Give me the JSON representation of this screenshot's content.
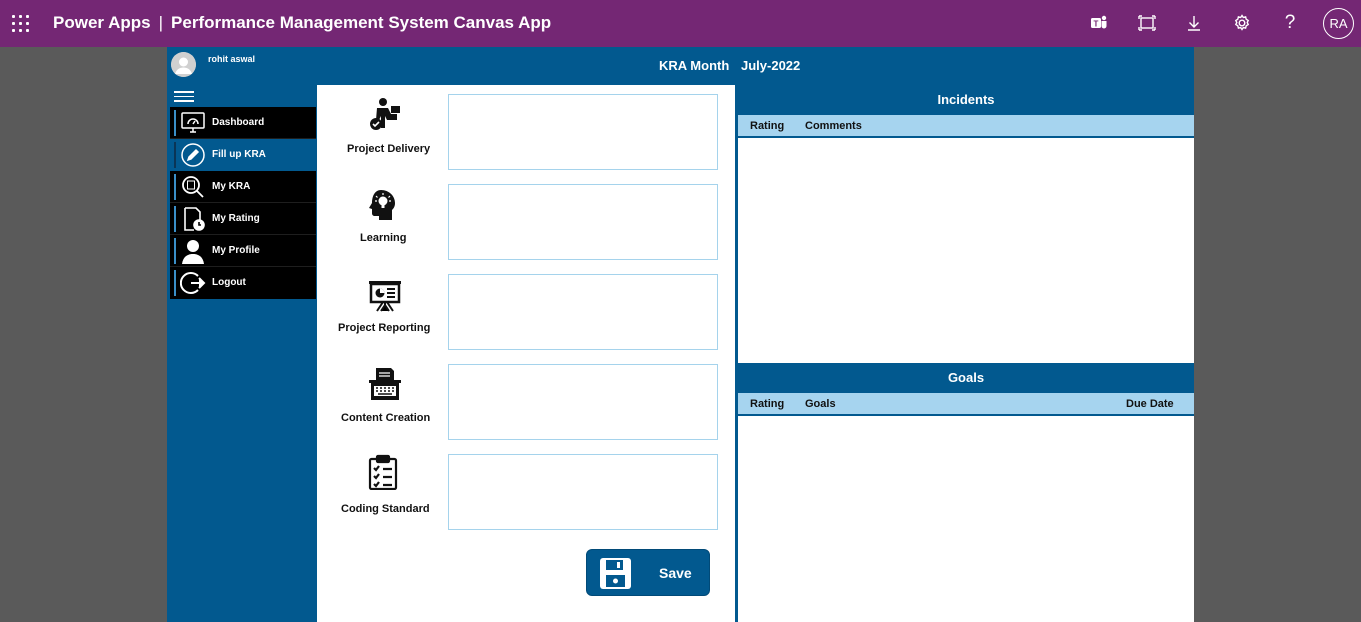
{
  "topbar": {
    "product": "Power Apps",
    "separator": "|",
    "app_name": "Performance Management System Canvas App",
    "user_initials": "RA",
    "icons": [
      "waffle-icon",
      "teams-icon",
      "fit-screen-icon",
      "download-icon",
      "settings-icon",
      "help-icon"
    ]
  },
  "header": {
    "user_name": "rohit aswal",
    "kra_month_label": "KRA Month",
    "kra_month_value": "July-2022"
  },
  "nav": {
    "items": [
      {
        "label": "Dashboard",
        "icon": "dashboard-icon",
        "active": false
      },
      {
        "label": "Fill up KRA",
        "icon": "edit-icon",
        "active": true
      },
      {
        "label": "My KRA",
        "icon": "search-icon",
        "active": false
      },
      {
        "label": "My Rating",
        "icon": "rating-icon",
        "active": false
      },
      {
        "label": "My Profile",
        "icon": "profile-icon",
        "active": false
      },
      {
        "label": "Logout",
        "icon": "logout-icon",
        "active": false
      }
    ]
  },
  "kras": [
    {
      "label": "Project Delivery",
      "icon": "delivery-icon",
      "value": ""
    },
    {
      "label": "Learning",
      "icon": "learning-icon",
      "value": ""
    },
    {
      "label": "Project Reporting",
      "icon": "reporting-icon",
      "value": ""
    },
    {
      "label": "Content Creation",
      "icon": "typewriter-icon",
      "value": ""
    },
    {
      "label": "Coding Standard",
      "icon": "checklist-icon",
      "value": ""
    }
  ],
  "save_label": "Save",
  "incidents": {
    "title": "Incidents",
    "columns": [
      "Rating",
      "Comments"
    ]
  },
  "goals": {
    "title": "Goals",
    "columns": [
      "Rating",
      "Goals",
      "Due Date"
    ]
  },
  "colors": {
    "topbar": "#742774",
    "primary": "#02598f",
    "header_row": "#a6d4ef",
    "nav_item": "#000000"
  }
}
